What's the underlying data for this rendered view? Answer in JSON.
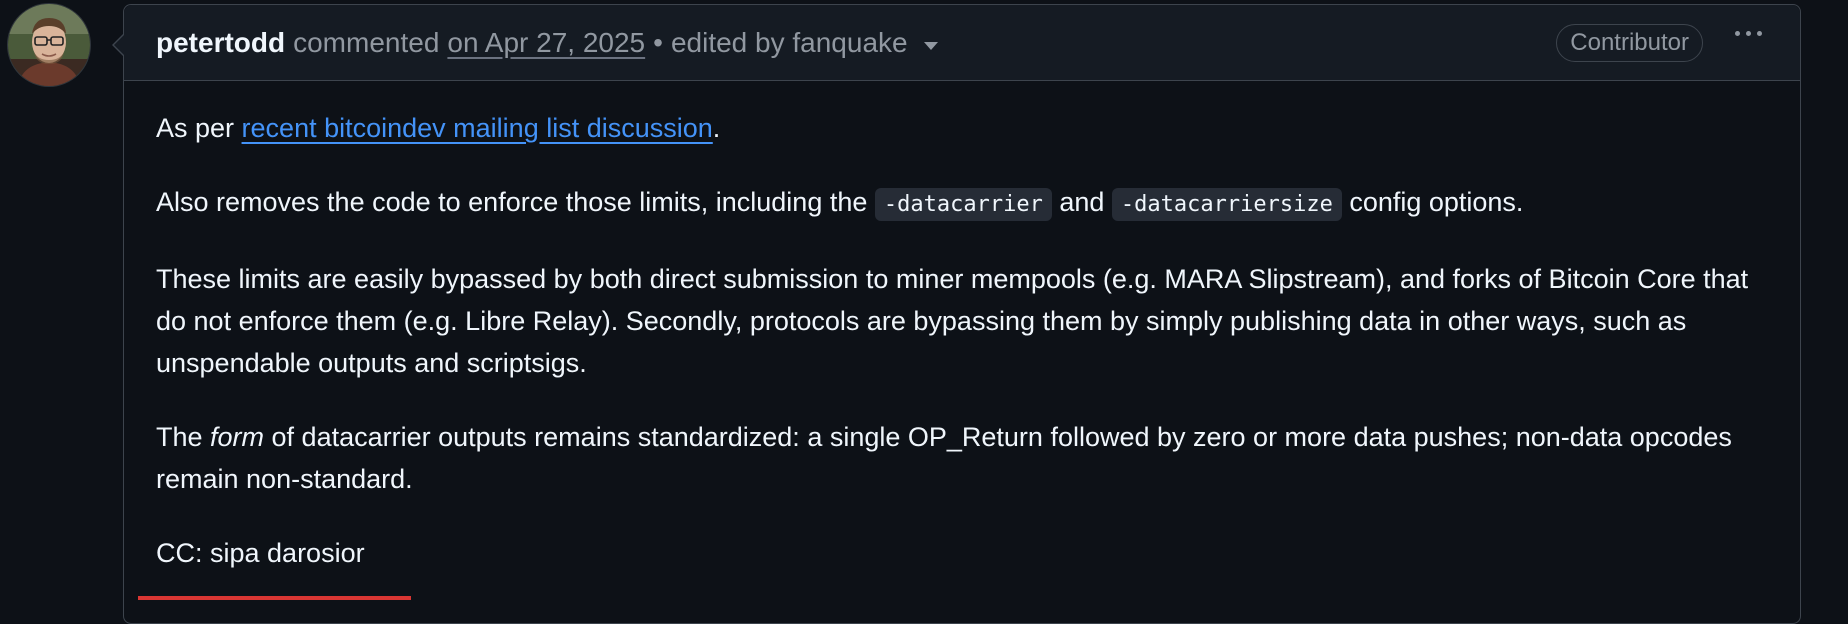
{
  "comment": {
    "author": "petertodd",
    "action": "commented",
    "date": "on Apr 27, 2025",
    "separator": "•",
    "edited": "edited by fanquake",
    "badge": "Contributor",
    "menu_icon": "kebab-horizontal-icon",
    "avatar_icon": "user-avatar"
  },
  "body": {
    "p1_prefix": "As per ",
    "p1_link": "recent bitcoindev mailing list discussion",
    "p1_suffix": ".",
    "p2_a": "Also removes the code to enforce those limits, including the ",
    "p2_code1": "-datacarrier",
    "p2_b": " and ",
    "p2_code2": "-datacarriersize",
    "p2_c": " config options.",
    "p3": "These limits are easily bypassed by both direct submission to miner mempools (e.g. MARA Slipstream), and forks of Bitcoin Core that do not enforce them (e.g. Libre Relay). Secondly, protocols are bypassing them by simply publishing data in other ways, such as unspendable outputs and scriptsigs.",
    "p4_a": "The ",
    "p4_em": "form",
    "p4_b": " of datacarrier outputs remains standardized: a single OP_Return followed by zero or more data pushes; non-data opcodes remain non-standard.",
    "p5": "CC: sipa darosior"
  },
  "colors": {
    "background": "#0d1117",
    "header_bg": "#151b23",
    "border": "#3d444d",
    "link": "#4493f8",
    "muted": "#9198a1",
    "accent_red": "#da3633"
  }
}
